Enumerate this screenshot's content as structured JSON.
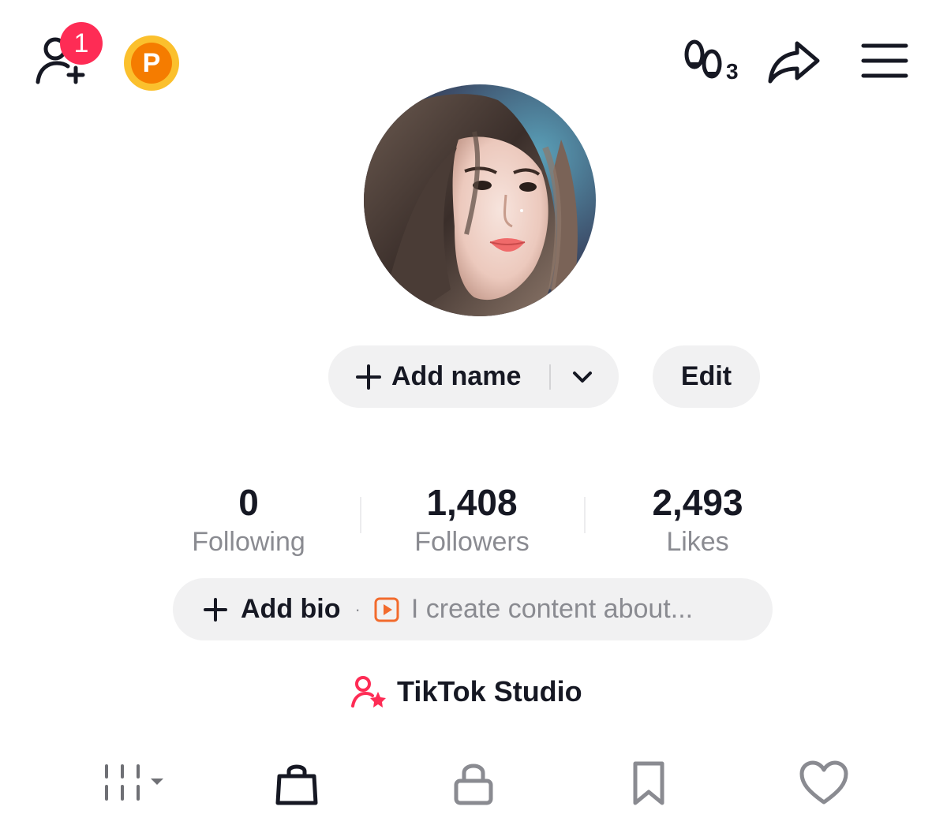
{
  "header": {
    "notification_badge": "1",
    "coin_label": "P",
    "footprint_count": "3"
  },
  "profile": {
    "add_name_label": "Add name",
    "edit_label": "Edit"
  },
  "stats": [
    {
      "value": "0",
      "label": "Following"
    },
    {
      "value": "1,408",
      "label": "Followers"
    },
    {
      "value": "2,493",
      "label": "Likes"
    }
  ],
  "bio": {
    "add_bio_label": "Add bio",
    "separator": "·",
    "hint": "I create content about..."
  },
  "studio": {
    "label": "TikTok Studio"
  },
  "tabs": [
    {
      "icon": "grid-icon"
    },
    {
      "icon": "shopping-bag-icon"
    },
    {
      "icon": "lock-icon"
    },
    {
      "icon": "bookmark-icon"
    },
    {
      "icon": "heart-icon"
    }
  ],
  "colors": {
    "accent": "#fe2c55",
    "pill_bg": "#f1f1f2",
    "muted_text": "#8a8b91",
    "coin_outer": "#fbc02d",
    "coin_inner": "#f57c00",
    "play_icon": "#f26b2d"
  }
}
